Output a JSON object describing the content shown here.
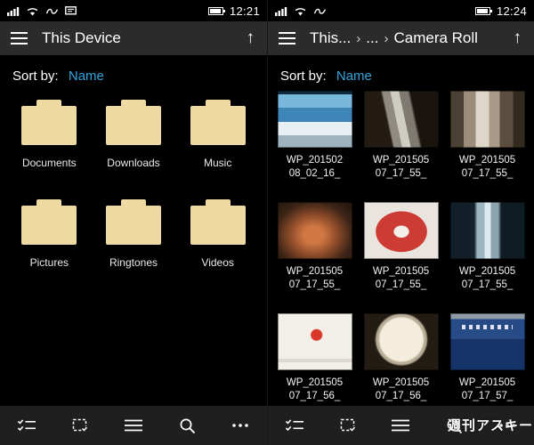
{
  "accent": "#35a3dc",
  "left": {
    "status": {
      "time": "12:21"
    },
    "titlebar": {
      "title": "This Device",
      "up_arrow": "↑"
    },
    "sort": {
      "label": "Sort by:",
      "value": "Name"
    },
    "folders": [
      "Documents",
      "Downloads",
      "Music",
      "Pictures",
      "Ringtones",
      "Videos"
    ]
  },
  "right": {
    "status": {
      "time": "12:24"
    },
    "breadcrumb": {
      "0": "This...",
      "1": "...",
      "2": "Camera Roll",
      "separator": "›"
    },
    "titlebar": {
      "up_arrow": "↑"
    },
    "sort": {
      "label": "Sort by:",
      "value": "Name"
    },
    "photos": [
      {
        "line1": "WP_201502",
        "line2": "08_02_16_",
        "thumb": "screenshot"
      },
      {
        "line1": "WP_201505",
        "line2": "07_17_55_",
        "thumb": "nokia-phone"
      },
      {
        "line1": "WP_201505",
        "line2": "07_17_55_",
        "thumb": "window"
      },
      {
        "line1": "WP_201505",
        "line2": "07_17_55_",
        "thumb": "remote-in-box"
      },
      {
        "line1": "WP_201505",
        "line2": "07_17_55_",
        "thumb": "red-house-box"
      },
      {
        "line1": "WP_201505",
        "line2": "07_17_55_",
        "thumb": "water-bottle"
      },
      {
        "line1": "WP_201505",
        "line2": "07_17_56_",
        "thumb": "wifi-prepaid-card"
      },
      {
        "line1": "WP_201505",
        "line2": "07_17_56_",
        "thumb": "round-object"
      },
      {
        "line1": "WP_201505",
        "line2": "07_17_57_",
        "thumb": "blue-product-box"
      }
    ],
    "watermark": "週刊アスキー"
  },
  "toolbar": {
    "icons": [
      "multiselect-list",
      "select",
      "list-view",
      "search",
      "more"
    ]
  },
  "status_icons": [
    "signal",
    "wifi",
    "vibrate",
    "message",
    "battery"
  ]
}
